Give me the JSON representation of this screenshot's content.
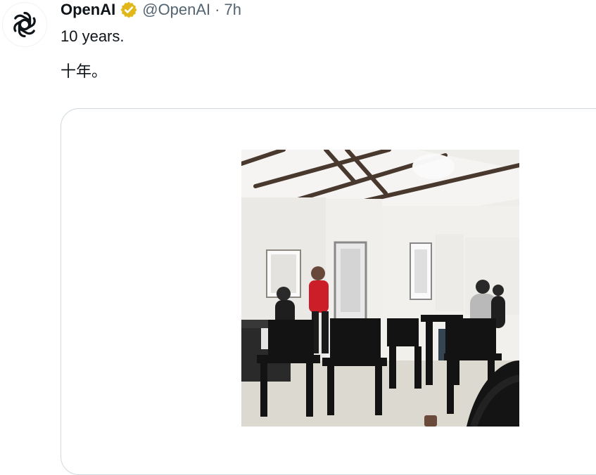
{
  "post": {
    "author_name": "OpenAI",
    "handle": "@OpenAI",
    "separator": "·",
    "timestamp": "7h",
    "text_lines": [
      "10 years.",
      "十年。"
    ]
  },
  "icons": {
    "avatar": "openai-logo-icon",
    "verified": "verified-badge-icon"
  },
  "colors": {
    "text_primary": "#0f1419",
    "text_secondary": "#536471",
    "card_border": "#cfd9de",
    "verified_gold": "#E2B719"
  }
}
